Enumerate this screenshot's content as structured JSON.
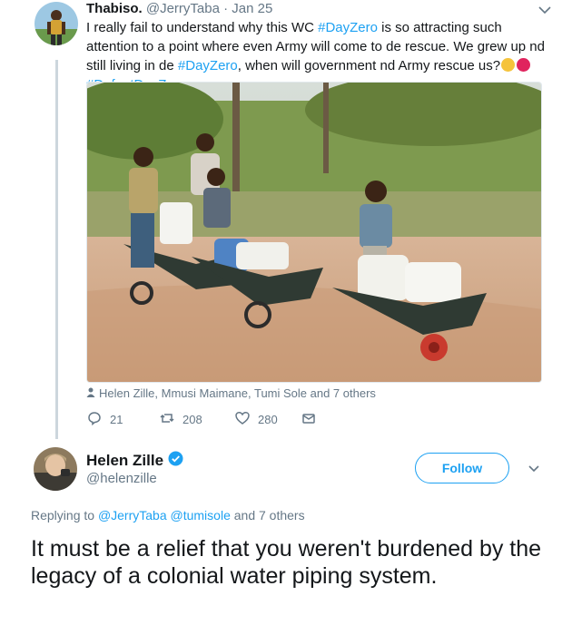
{
  "tweet1": {
    "name": "Thabiso.",
    "handle": "@JerryTaba",
    "separator": "·",
    "date": "Jan 25",
    "text_part1": "I really fail to understand why this WC ",
    "hashtag1": "#DayZero",
    "text_part2": " is so attracting such attention to a point where even Army will come to de rescue. We grew up nd still living in de ",
    "hashtag2": "#DayZero",
    "text_part3": ", when will government nd Army rescue us?",
    "hashtag3": "#DefeatDayZero",
    "emojis": [
      "weary-face-emoji",
      "angry-face-emoji"
    ],
    "tagged_people": "Helen Zille, Mmusi Maimane, Tumi Sole and 7 others",
    "actions": {
      "replies": "21",
      "retweets": "208",
      "likes": "280"
    }
  },
  "tweet2": {
    "name": "Helen Zille",
    "handle": "@helenzille",
    "follow_label": "Follow",
    "replying_prefix": "Replying to ",
    "replying_users": "@JerryTaba @tumisole",
    "replying_suffix": " and 7 others",
    "text": "It must be a relief that you weren't burdened by the legacy of a colonial water piping system."
  },
  "colors": {
    "accent": "#1da1f2",
    "muted": "#657786",
    "text": "#14171a",
    "thread_line": "#ccd6dd"
  }
}
